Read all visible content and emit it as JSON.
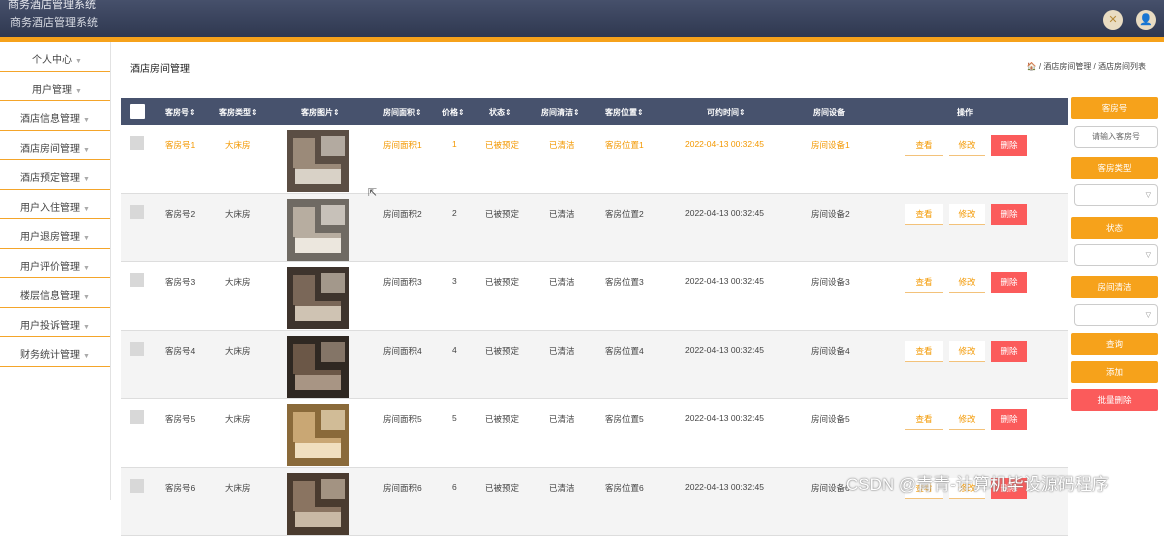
{
  "header": {
    "title_top": "商务酒店管理系统",
    "title_sub": "商务酒店管理系统",
    "icons": [
      "close-icon",
      "user-icon"
    ]
  },
  "sidebar": {
    "items": [
      {
        "label": "个人中心"
      },
      {
        "label": "用户管理"
      },
      {
        "label": "酒店信息管理"
      },
      {
        "label": "酒店房间管理"
      },
      {
        "label": "酒店预定管理"
      },
      {
        "label": "用户入住管理"
      },
      {
        "label": "用户退房管理"
      },
      {
        "label": "用户评价管理"
      },
      {
        "label": "楼层信息管理"
      },
      {
        "label": "用户投诉管理"
      },
      {
        "label": "财务统计管理"
      }
    ]
  },
  "main": {
    "title": "酒店房间管理",
    "breadcrumb": "🏠 / 酒店房间管理 / 酒店房间列表"
  },
  "table": {
    "columns": [
      "客房号",
      "客房类型",
      "客房图片",
      "房间面积",
      "价格",
      "状态",
      "房间清洁",
      "客房位置",
      "可约时间",
      "房间设备",
      "操作"
    ],
    "actions": {
      "view": "查看",
      "edit": "修改",
      "delete": "删除"
    },
    "rows": [
      {
        "no": "客房号1",
        "type": "大床房",
        "area": "房间面积1",
        "price": "1",
        "status": "已被预定",
        "clean": "已清洁",
        "pos": "客房位置1",
        "time": "2022-04-13 00:32:45",
        "equip": "房间设备1"
      },
      {
        "no": "客房号2",
        "type": "大床房",
        "area": "房间面积2",
        "price": "2",
        "status": "已被预定",
        "clean": "已清洁",
        "pos": "客房位置2",
        "time": "2022-04-13 00:32:45",
        "equip": "房间设备2"
      },
      {
        "no": "客房号3",
        "type": "大床房",
        "area": "房间面积3",
        "price": "3",
        "status": "已被预定",
        "clean": "已清洁",
        "pos": "客房位置3",
        "time": "2022-04-13 00:32:45",
        "equip": "房间设备3"
      },
      {
        "no": "客房号4",
        "type": "大床房",
        "area": "房间面积4",
        "price": "4",
        "status": "已被预定",
        "clean": "已清洁",
        "pos": "客房位置4",
        "time": "2022-04-13 00:32:45",
        "equip": "房间设备4"
      },
      {
        "no": "客房号5",
        "type": "大床房",
        "area": "房间面积5",
        "price": "5",
        "status": "已被预定",
        "clean": "已清洁",
        "pos": "客房位置5",
        "time": "2022-04-13 00:32:45",
        "equip": "房间设备5"
      },
      {
        "no": "客房号6",
        "type": "大床房",
        "area": "房间面积6",
        "price": "6",
        "status": "已被预定",
        "clean": "已清洁",
        "pos": "客房位置6",
        "time": "2022-04-13 00:32:45",
        "equip": "房间设备6"
      }
    ]
  },
  "search": {
    "room_no_label": "客房号",
    "room_no_placeholder": "请输入客房号",
    "room_type_label": "客房类型",
    "status_label": "状态",
    "clean_label": "房间清洁",
    "query": "查询",
    "add": "添加",
    "batch_delete": "批量删除"
  },
  "watermark": "CSDN @青青-计算机毕设源码程序",
  "colors": {
    "accent": "#f6a21b",
    "header": "#3b4560",
    "table_head": "#47526d",
    "danger": "#fb5b5b"
  }
}
